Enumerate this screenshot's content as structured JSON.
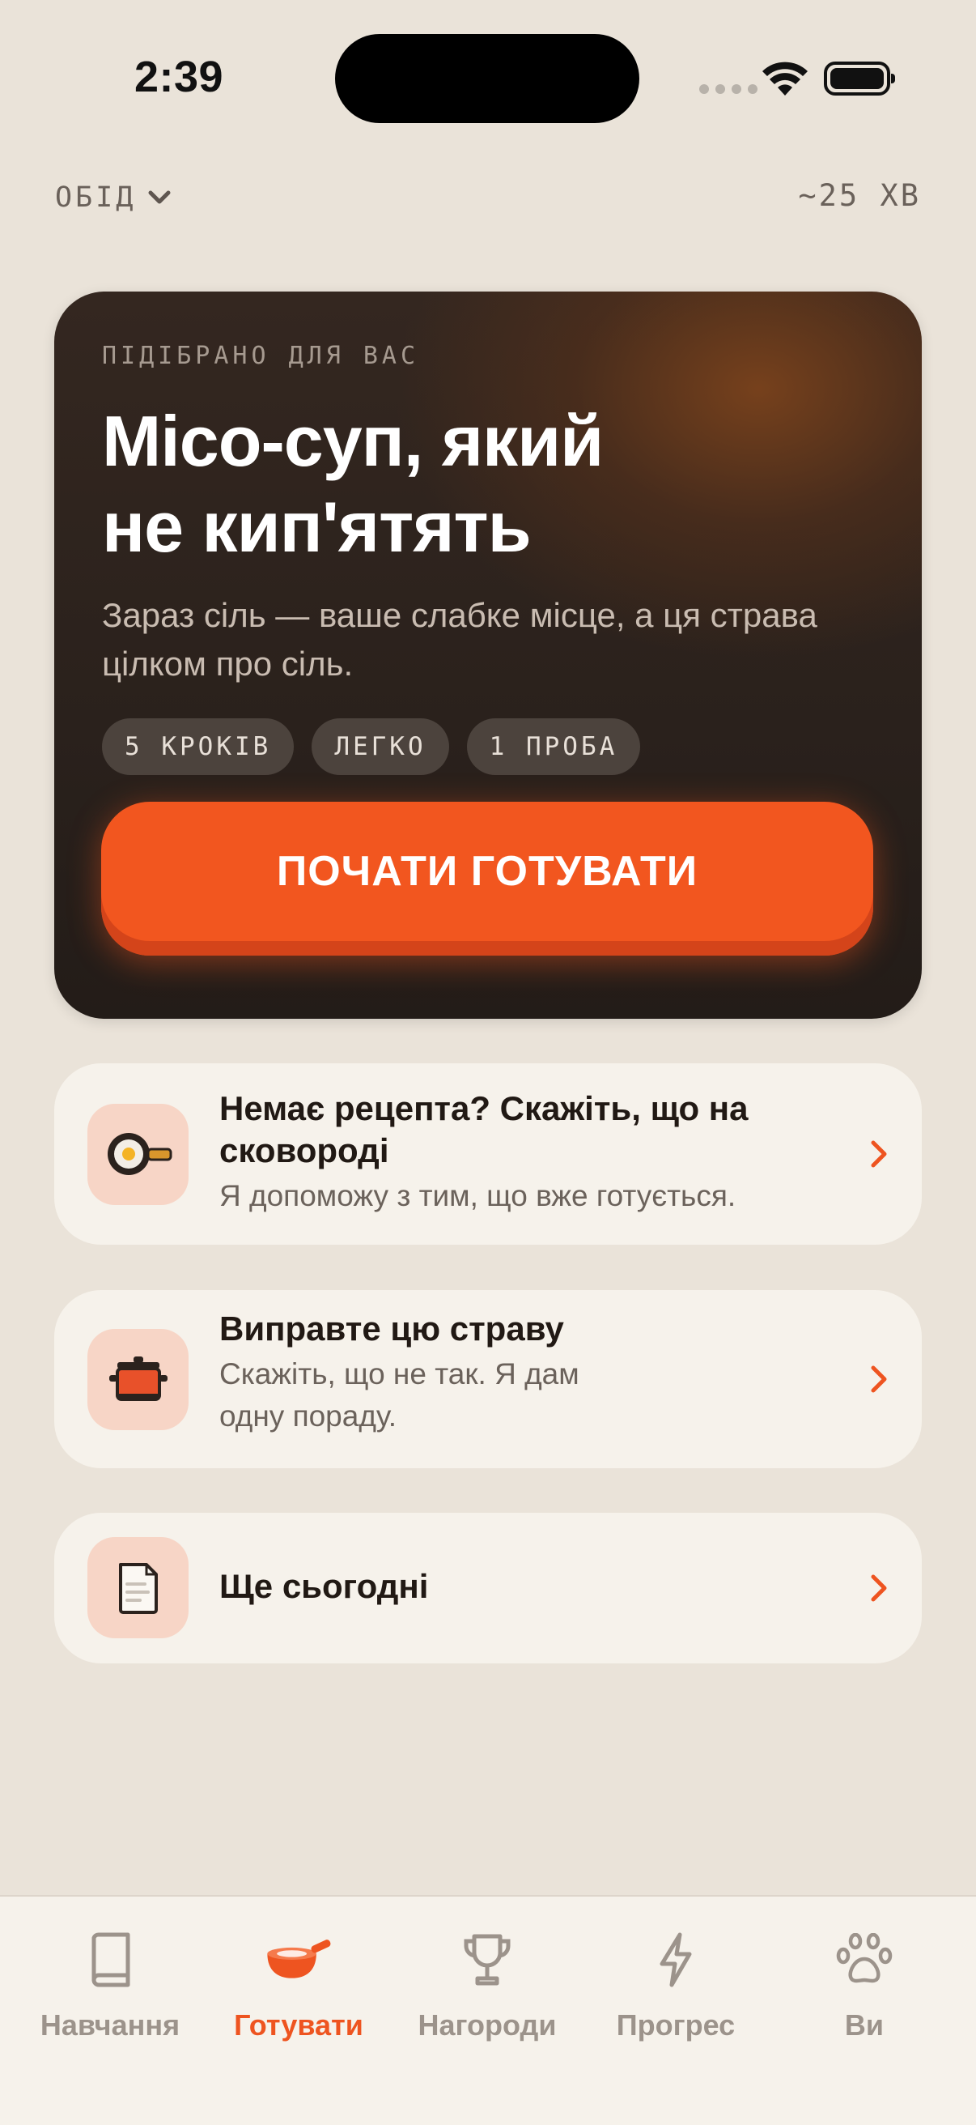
{
  "status_bar": {
    "time": "2:39"
  },
  "header": {
    "meal_selector": "ОБІД",
    "duration": "~25 ХВ"
  },
  "hero": {
    "eyebrow": "ПІДІБРАНО ДЛЯ ВАС",
    "title_line1": "Місо-суп, який",
    "title_line2": "не кип'ятять",
    "subtitle": "Зараз сіль — ваше слабке місце, а ця страва цілком про сіль.",
    "tags": [
      "5 КРОКІВ",
      "ЛЕГКО",
      "1 ПРОБА"
    ],
    "cta_label": "ПОЧАТИ ГОТУВАТИ"
  },
  "cards": [
    {
      "title": "Немає рецепта? Скажіть, що на сковороді",
      "subtitle": "Я допоможу з тим, що вже готується.",
      "icon": "frying-pan-icon"
    },
    {
      "title": "Виправте цю страву",
      "subtitle": "Скажіть, що не так. Я дам одну пораду.",
      "icon": "pot-icon"
    },
    {
      "title": "Ще сьогодні",
      "subtitle": "",
      "icon": "document-icon"
    }
  ],
  "tabbar": {
    "tabs": [
      {
        "label": "Навчання",
        "icon": "book-icon"
      },
      {
        "label": "Готувати",
        "icon": "pan-icon",
        "active": true
      },
      {
        "label": "Нагороди",
        "icon": "trophy-icon"
      },
      {
        "label": "Прогрес",
        "icon": "lightning-icon"
      },
      {
        "label": "Ви",
        "icon": "paw-icon"
      }
    ]
  },
  "colors": {
    "accent": "#F2561F",
    "background": "#EAE3D9",
    "card": "#F6F2EB",
    "hero_dark": "#2A211C",
    "icon_tile": "#F7D5C6",
    "inactive": "#9C938B"
  }
}
